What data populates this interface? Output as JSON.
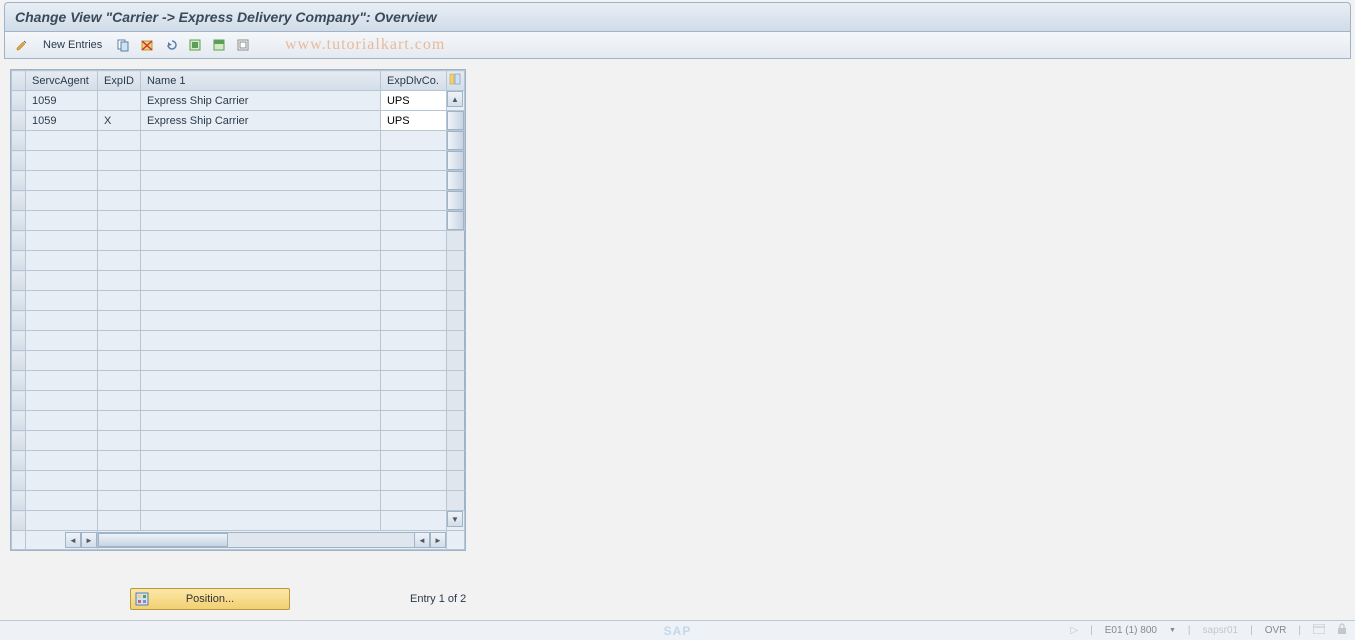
{
  "title": "Change View \"Carrier -> Express Delivery Company\": Overview",
  "toolbar": {
    "new_entries_label": "New Entries"
  },
  "watermark": "www.tutorialkart.com",
  "columns": {
    "servcagent": "ServcAgent",
    "expid": "ExpID",
    "name1": "Name 1",
    "expdlvco": "ExpDlvCo."
  },
  "rows": [
    {
      "servcagent": "1059",
      "expid": "",
      "name1": "Express Ship Carrier",
      "expdlvco": "UPS"
    },
    {
      "servcagent": "1059",
      "expid": "X",
      "name1": "Express Ship Carrier",
      "expdlvco": "UPS"
    }
  ],
  "empty_row_count": 20,
  "position_button_label": "Position...",
  "entry_text": "Entry 1 of 2",
  "status": {
    "system": "E01 (1) 800",
    "client": "sapsr01",
    "mode": "OVR"
  }
}
